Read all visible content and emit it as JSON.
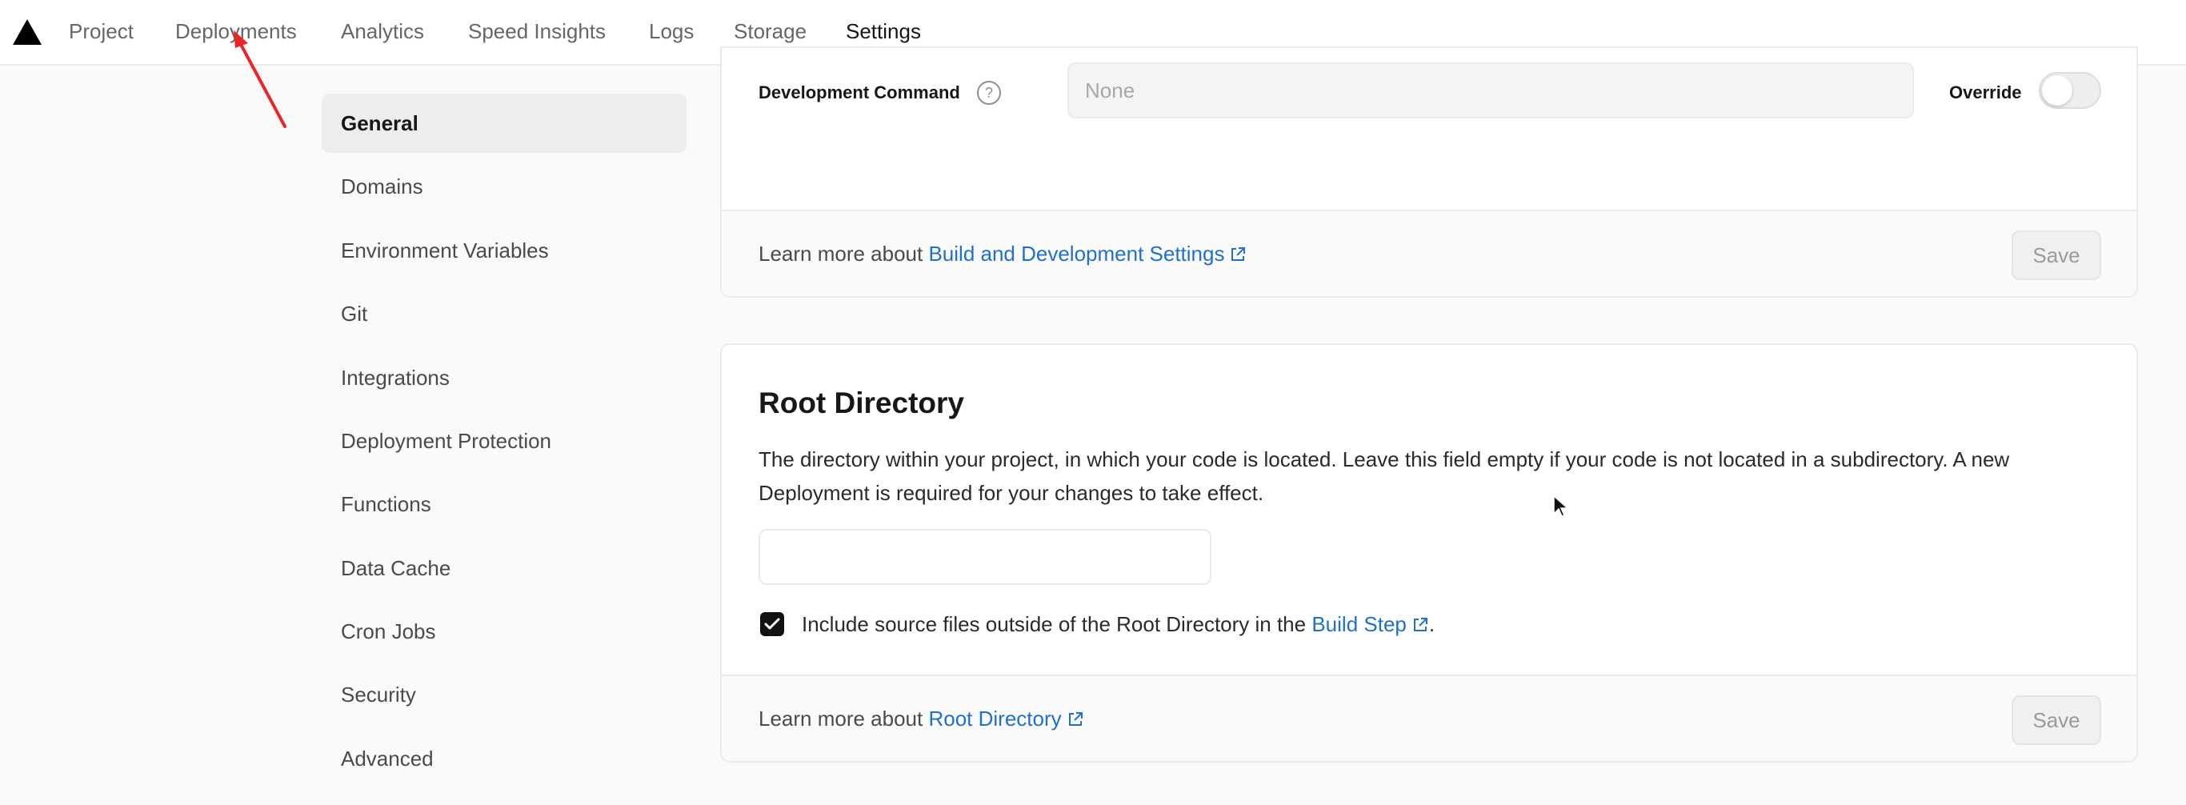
{
  "nav": {
    "tabs": [
      "Project",
      "Deployments",
      "Analytics",
      "Speed Insights",
      "Logs",
      "Storage",
      "Settings"
    ],
    "active_tab": "Settings"
  },
  "sidebar": {
    "items": [
      "General",
      "Domains",
      "Environment Variables",
      "Git",
      "Integrations",
      "Deployment Protection",
      "Functions",
      "Data Cache",
      "Cron Jobs",
      "Security",
      "Advanced"
    ],
    "active_item": "General"
  },
  "build_settings": {
    "dev_command_label": "Development Command",
    "dev_command_placeholder": "None",
    "dev_command_value": "",
    "override_label": "Override",
    "override_enabled": false,
    "learn_more_prefix": "Learn more about ",
    "learn_more_link": "Build and Development Settings",
    "save_label": "Save"
  },
  "root_directory": {
    "title": "Root Directory",
    "description": "The directory within your project, in which your code is located. Leave this field empty if your code is not located in a subdirectory. A new Deployment is required for your changes to take effect.",
    "input_value": "",
    "include_checkbox_checked": true,
    "include_label_prefix": "Include source files outside of the Root Directory in the ",
    "include_label_link": "Build Step",
    "include_label_suffix": ".",
    "learn_more_prefix": "Learn more about ",
    "learn_more_link": "Root Directory",
    "save_label": "Save"
  },
  "colors": {
    "link": "#1f6fd1",
    "annotation_arrow": "#e8262a",
    "active_text": "#171717",
    "muted_text": "#666666"
  }
}
